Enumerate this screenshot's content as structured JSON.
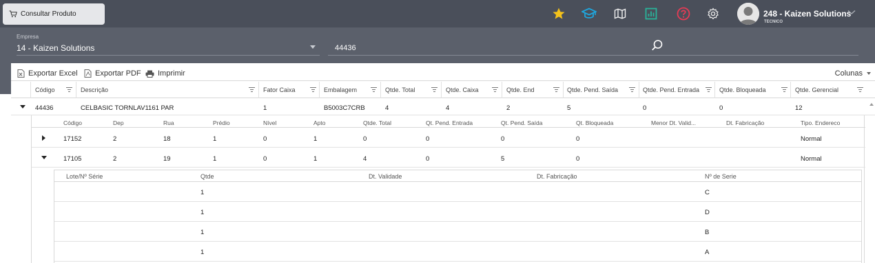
{
  "tab": {
    "title": "Consultar Produto"
  },
  "user": {
    "name": "248 - Kaizen Solutions",
    "role": "TECNICO"
  },
  "top_icons": [
    "star-icon",
    "graduation-cap-icon",
    "map-icon",
    "report-icon",
    "help-icon",
    "gear-icon"
  ],
  "colors": {
    "star": "#f4c21b",
    "cap": "#1ea7df",
    "report": "#29b39a",
    "help": "#e83b55",
    "topbar": "#4a4f5a",
    "band": "#5b606b"
  },
  "filters": {
    "empresa_label": "Empresa",
    "empresa_value": "14 - Kaizen Solutions",
    "search_value": "44436"
  },
  "toolbar": {
    "export_excel": "Exportar Excel",
    "export_pdf": "Exportar PDF",
    "print": "Imprimir",
    "columns": "Colunas"
  },
  "grid": {
    "headers": [
      "Código",
      "Descrição",
      "Fator Caixa",
      "Embalagem",
      "Qtde. Total",
      "Qtde. Caixa",
      "Qtde. End",
      "Qtde. Pend. Saída",
      "Qtde. Pend. Entrada",
      "Qtde. Bloqueada",
      "Qtde. Gerencial"
    ],
    "row": [
      "44436",
      "CELBASIC TORNLAV1161 PAR",
      "1",
      "B5003C7CRB",
      "4",
      "4",
      "2",
      "5",
      "0",
      "0",
      "12"
    ]
  },
  "detail": {
    "headers": [
      "Código",
      "Dep",
      "Rua",
      "Prédio",
      "Nível",
      "Apto",
      "Qtde. Total",
      "Qt. Pend. Entrada",
      "Qt. Pend. Saída",
      "Qt. Bloqueada",
      "Menor Dt. Valid...",
      "Dt. Fabricação",
      "Tipo. Endereco"
    ],
    "rows": [
      [
        "17152",
        "2",
        "18",
        "1",
        "0",
        "1",
        "0",
        "0",
        "0",
        "0",
        "",
        "",
        "Normal"
      ],
      [
        "17105",
        "2",
        "19",
        "1",
        "0",
        "1",
        "4",
        "0",
        "5",
        "0",
        "",
        "",
        "Normal"
      ]
    ]
  },
  "lotes": {
    "headers": [
      "Lote/Nº Série",
      "Qtde",
      "Dt. Validade",
      "Dt. Fabricação",
      "Nº de Serie"
    ],
    "rows": [
      [
        "",
        "1",
        "",
        "",
        "C"
      ],
      [
        "",
        "1",
        "",
        "",
        "D"
      ],
      [
        "",
        "1",
        "",
        "",
        "B"
      ],
      [
        "",
        "1",
        "",
        "",
        "A"
      ]
    ]
  }
}
